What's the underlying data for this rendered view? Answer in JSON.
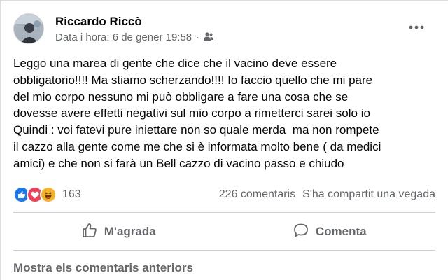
{
  "post": {
    "author": "Riccardo Riccò",
    "timestamp": "Data i hora: 6 de gener 19:58",
    "audience_icon": "friends-icon",
    "more_icon": "more-options-icon",
    "text": "Leggo una marea di gente che dice che il vacino deve essere\nobbligatorio!!!! Ma stiamo scherzando!!!! Io faccio quello che mi pare\ndel mio corpo nessuno mi può obbligare a fare una cosa che se\ndovesse avere effetti negativi sul mio corpo a rimetterci sarei solo io\nQuindi : voi fatevi pure iniettare non so quale merda  ma non rompete\nil cazzo alla gente come me che si è informata molto bene ( da medici\namici) e che non si farà un Bell cazzo di vacino passo e chiudo"
  },
  "stats": {
    "reactions": [
      "like",
      "love",
      "haha"
    ],
    "reaction_count": "163",
    "comments": "226 comentaris",
    "shares": "S'ha compartit una vegada"
  },
  "actions": {
    "like_label": "M'agrada",
    "comment_label": "Comenta"
  },
  "comments": {
    "show_previous": "Mostra els comentaris anteriors"
  },
  "colors": {
    "text_primary": "#050505",
    "text_secondary": "#65676b",
    "like_blue": "#1877f2",
    "love_red": "#f33e58",
    "haha_yellow": "#f7b125",
    "divider": "#ced0d4"
  }
}
